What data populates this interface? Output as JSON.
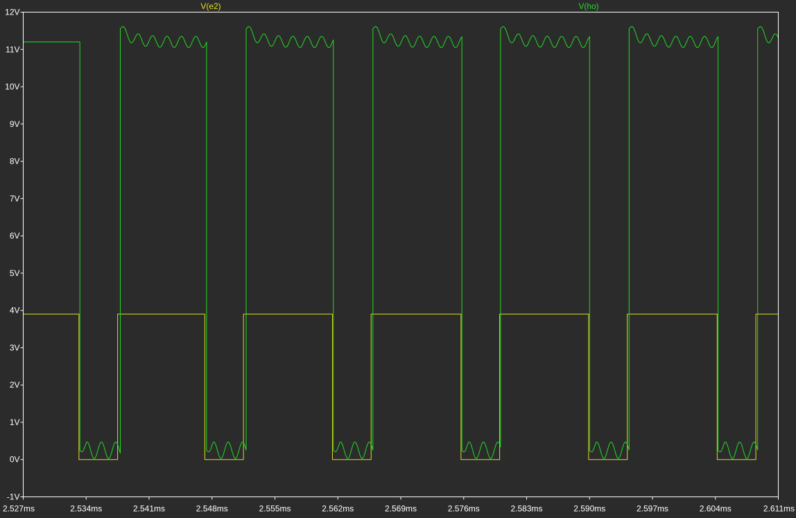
{
  "chart_data": {
    "type": "line",
    "title": "",
    "xlabel": "",
    "ylabel": "",
    "xlim": [
      2.527,
      2.611
    ],
    "ylim": [
      -1,
      12
    ],
    "x_unit": "ms",
    "y_unit": "V",
    "grid": false,
    "legend_placement": "top",
    "background_color": "#2b2b2b",
    "axis_color": "#ffffff",
    "tick_label_color": "#ffffff",
    "y_ticks": [
      {
        "value": 12,
        "label": "12V"
      },
      {
        "value": 11,
        "label": "11V"
      },
      {
        "value": 10,
        "label": "10V"
      },
      {
        "value": 9,
        "label": "9V"
      },
      {
        "value": 8,
        "label": "8V"
      },
      {
        "value": 7,
        "label": "7V"
      },
      {
        "value": 6,
        "label": "6V"
      },
      {
        "value": 5,
        "label": "5V"
      },
      {
        "value": 4,
        "label": "4V"
      },
      {
        "value": 3,
        "label": "3V"
      },
      {
        "value": 2,
        "label": "2V"
      },
      {
        "value": 1,
        "label": "1V"
      },
      {
        "value": 0,
        "label": "0V"
      },
      {
        "value": -1,
        "label": "-1V"
      }
    ],
    "x_ticks": [
      {
        "value": 2.527,
        "label": "2.527ms"
      },
      {
        "value": 2.534,
        "label": "2.534ms"
      },
      {
        "value": 2.541,
        "label": "2.541ms"
      },
      {
        "value": 2.548,
        "label": "2.548ms"
      },
      {
        "value": 2.555,
        "label": "2.555ms"
      },
      {
        "value": 2.562,
        "label": "2.562ms"
      },
      {
        "value": 2.569,
        "label": "2.569ms"
      },
      {
        "value": 2.576,
        "label": "2.576ms"
      },
      {
        "value": 2.583,
        "label": "2.583ms"
      },
      {
        "value": 2.59,
        "label": "2.590ms"
      },
      {
        "value": 2.597,
        "label": "2.597ms"
      },
      {
        "value": 2.604,
        "label": "2.604ms"
      },
      {
        "value": 2.611,
        "label": "2.611ms"
      }
    ],
    "series": [
      {
        "name": "V(e2)",
        "color": "#e0e020",
        "high": 3.9,
        "low": 0,
        "intervals_low": [
          [
            2.5332,
            2.5375
          ],
          [
            2.5472,
            2.5515
          ],
          [
            2.5614,
            2.5657
          ],
          [
            2.5757,
            2.58
          ],
          [
            2.5899,
            2.5942
          ],
          [
            2.6042,
            2.6085
          ]
        ],
        "x": [
          2.527,
          2.5332,
          2.5332,
          2.5375,
          2.5375,
          2.5472,
          2.5472,
          2.5515,
          2.5515,
          2.5614,
          2.5614,
          2.5657,
          2.5657,
          2.5757,
          2.5757,
          2.58,
          2.58,
          2.5899,
          2.5899,
          2.5942,
          2.5942,
          2.6042,
          2.6042,
          2.6085,
          2.6085,
          2.611
        ],
        "values": [
          3.9,
          3.9,
          0,
          0,
          3.9,
          3.9,
          0,
          0,
          3.9,
          3.9,
          0,
          0,
          3.9,
          3.9,
          0,
          0,
          3.9,
          3.9,
          0,
          0,
          3.9,
          3.9,
          0,
          0,
          3.9,
          3.9
        ]
      },
      {
        "name": "V(ho)",
        "color": "#22dd22",
        "high_level": 11.2,
        "low_level": 0.25,
        "ripple_amplitude_high": 0.15,
        "ripple_amplitude_low": 0.22,
        "ripple_period": 0.0016,
        "overshoot_peak": 11.55,
        "intervals_low": [
          [
            2.5333,
            2.5378
          ],
          [
            2.5474,
            2.5518
          ],
          [
            2.5615,
            2.5659
          ],
          [
            2.5758,
            2.5801
          ],
          [
            2.59,
            2.5944
          ],
          [
            2.6043,
            2.6087
          ]
        ]
      }
    ]
  }
}
